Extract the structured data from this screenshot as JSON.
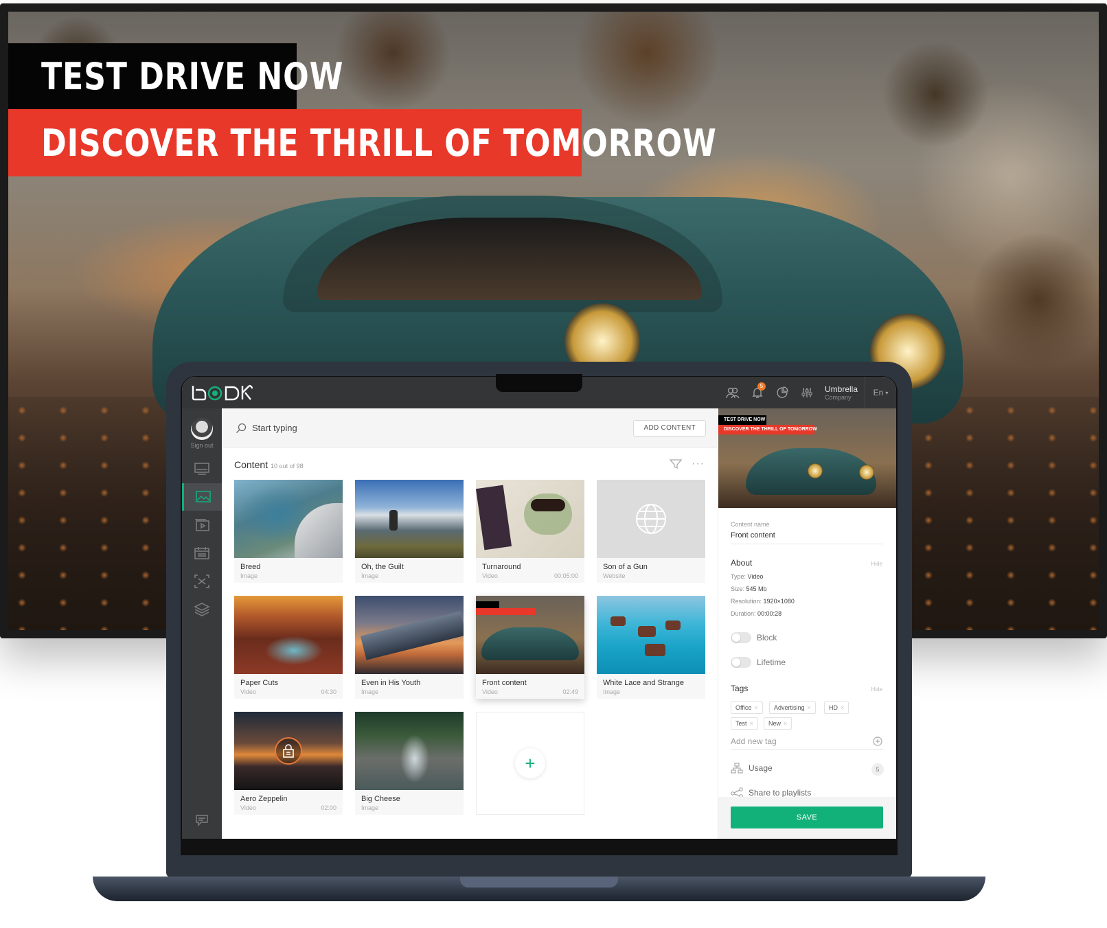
{
  "tv": {
    "headline": "TEST DRIVE NOW",
    "subheadline": "DISCOVER THE THRILL OF TOMORROW",
    "colors": {
      "black_banner": "#050505",
      "red_banner": "#e8382a"
    }
  },
  "app": {
    "header": {
      "notifications_count": "5",
      "user_name": "Umbrella",
      "user_role": "Company",
      "language": "En"
    },
    "sidebar": {
      "sign_out_label": "Sign out",
      "items": [
        {
          "icon": "display-icon"
        },
        {
          "icon": "image-gallery-icon",
          "active": true
        },
        {
          "icon": "playlist-icon"
        },
        {
          "icon": "calendar-icon"
        },
        {
          "icon": "fullscreen-icon"
        },
        {
          "icon": "layers-icon"
        }
      ],
      "chat_icon": "chat-icon"
    },
    "search": {
      "placeholder": "Start typing",
      "add_content_label": "ADD CONTENT"
    },
    "content": {
      "title": "Content",
      "count": "10 out of 98",
      "items": [
        {
          "name": "Breed",
          "type": "Image",
          "duration": ""
        },
        {
          "name": "Oh, the Guilt",
          "type": "Image",
          "duration": ""
        },
        {
          "name": "Turnaround",
          "type": "Video",
          "duration": "00:05:00"
        },
        {
          "name": "Son of a Gun",
          "type": "Website",
          "duration": ""
        },
        {
          "name": "Paper Cuts",
          "type": "Video",
          "duration": "04:30"
        },
        {
          "name": "Even in His Youth",
          "type": "Image",
          "duration": ""
        },
        {
          "name": "Front content",
          "type": "Video",
          "duration": "02:49"
        },
        {
          "name": "White Lace and Strange",
          "type": "Image",
          "duration": ""
        },
        {
          "name": "Aero Zeppelin",
          "type": "Video",
          "duration": "02:00"
        },
        {
          "name": "Big Cheese",
          "type": "Image",
          "duration": ""
        }
      ]
    },
    "details": {
      "preview_headline": "TEST DRIVE NOW",
      "preview_subheadline": "DISCOVER THE THRILL OF TOMORROW",
      "content_name_label": "Content name",
      "content_name": "Front content",
      "about_title": "About",
      "hide_label": "Hide",
      "type_label": "Type:",
      "type_value": "Video",
      "size_label": "Size:",
      "size_value": "545 Mb",
      "resolution_label": "Resolution:",
      "resolution_value": "1920×1080",
      "duration_label": "Duration:",
      "duration_value": "00:00:28",
      "block_label": "Block",
      "lifetime_label": "Lifetime",
      "tags_title": "Tags",
      "tags": [
        "Office",
        "Advertising",
        "HD",
        "Test",
        "New"
      ],
      "add_tag_placeholder": "Add new tag",
      "usage_label": "Usage",
      "usage_count": "5",
      "share_label": "Share to playlists",
      "save_label": "SAVE",
      "accent_color": "#12b17a"
    }
  }
}
